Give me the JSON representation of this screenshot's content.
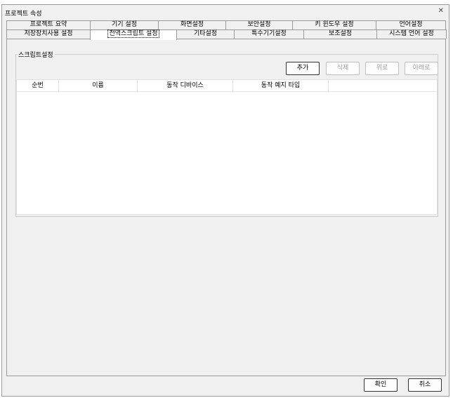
{
  "window": {
    "title": "프로젝트 속성",
    "close_icon": "close-icon"
  },
  "tabs_row1": [
    {
      "label": "프로젝트 요약"
    },
    {
      "label": "기기 설정"
    },
    {
      "label": "화면설정"
    },
    {
      "label": "보안설정"
    },
    {
      "label": "키 윈도우 설정"
    },
    {
      "label": "언어설정"
    }
  ],
  "tabs_row2": [
    {
      "label": "저장장치사용 설정"
    },
    {
      "label": "전역스크립트 설정",
      "selected": true
    },
    {
      "label": "기타설정"
    },
    {
      "label": "특수기기설정"
    },
    {
      "label": "보조설정"
    },
    {
      "label": "시스템 언어 설정"
    }
  ],
  "script_group": {
    "title": "스크립트설정",
    "buttons": {
      "add": "추가",
      "delete": "삭제",
      "up": "위로",
      "down": "아래로"
    },
    "columns": [
      "순번",
      "이름",
      "동작 디바이스",
      "동작 예지 타입",
      ""
    ],
    "rows": []
  },
  "footer": {
    "ok": "확인",
    "cancel": "취소"
  }
}
